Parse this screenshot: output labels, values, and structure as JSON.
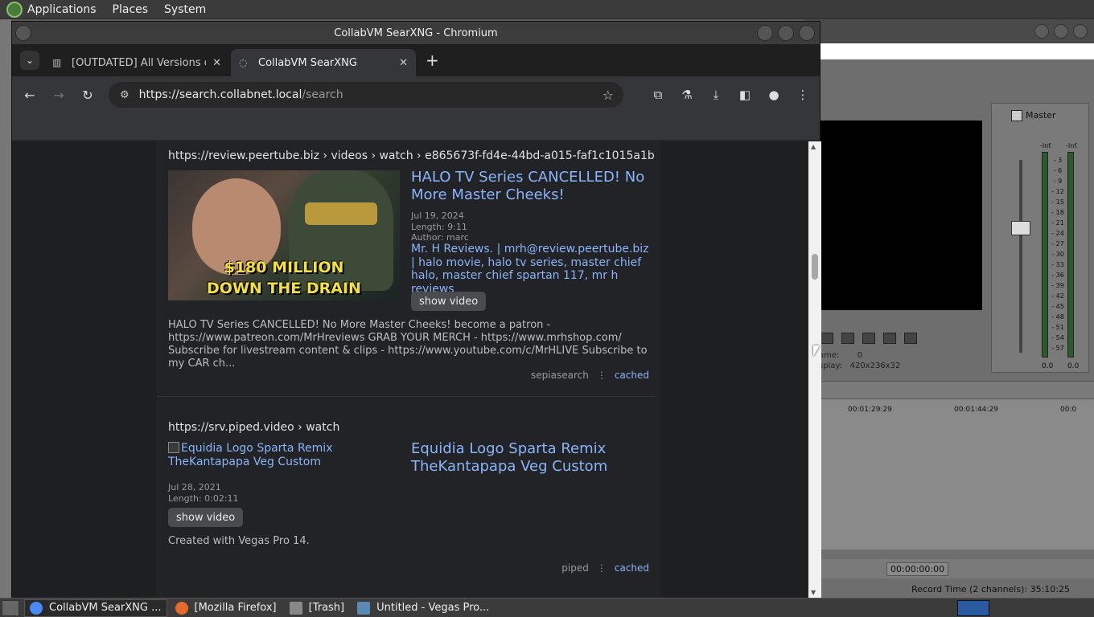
{
  "top_panel": {
    "menus": [
      "Applications",
      "Places",
      "System"
    ]
  },
  "vegas": {
    "master_label": "Master",
    "frame_label": "ame:",
    "frame_value": "0",
    "display_label": "splay:",
    "display_value": "420x236x32",
    "ruler": [
      "00:01:29:29",
      "00:01:44:29",
      "00:0"
    ],
    "timecode": "00:00:00:00",
    "record_time": "Record Time (2 channels): 35:10:25",
    "meter_scale": [
      "3",
      "6",
      "9",
      "12",
      "15",
      "18",
      "21",
      "24",
      "27",
      "30",
      "33",
      "36",
      "39",
      "42",
      "45",
      "48",
      "51",
      "54",
      "57"
    ],
    "inf_left": "-Inf.",
    "inf_right": "-Inf.",
    "zero_left": "0.0",
    "zero_right": "0.0"
  },
  "window": {
    "title": "CollabVM SearXNG - Chromium"
  },
  "tabs": [
    {
      "label": "[OUTDATED] All Versions of",
      "active": false
    },
    {
      "label": "CollabVM SearXNG",
      "active": true
    }
  ],
  "omnibox": {
    "host": "https://search.collabnet.local",
    "path": "/search"
  },
  "results": [
    {
      "url": "https://review.peertube.biz  › videos › watch › e865673f-fd4e-44bd-a015-faf1c1015a1b",
      "thumbnail_caption_1": "$180 MILLION",
      "thumbnail_caption_2": "DOWN THE DRAIN",
      "title": "HALO TV Series CANCELLED! No More Master Cheeks!",
      "date": "Jul 19, 2024",
      "length": "Length: 9:11",
      "author": "Author: marc",
      "tags": "Mr. H Reviews. | mrh@review.peertube.biz | halo movie, halo tv series, master chief halo, master chief spartan 117, mr h reviews",
      "show_video": "show video",
      "content": "HALO TV Series CANCELLED! No More Master Cheeks! become a patron - https://www.patreon.com/MrHreviews GRAB YOUR MERCH - https://www.mrhshop.com/ Subscribe for livestream content & clips - https://www.youtube.com/c/MrHLIVE Subscribe to my CAR ch...",
      "engine": "sepiasearch",
      "cached": "cached"
    },
    {
      "url": "https://srv.piped.video  › watch",
      "img_alt": "Equidia Logo Sparta Remix TheKantapapa Veg Custom",
      "title": "Equidia Logo Sparta Remix TheKantapapa Veg Custom",
      "date": "Jul 28, 2021",
      "length": "Length: 0:02:11",
      "show_video": "show video",
      "content": "Created with Vegas Pro 14.",
      "engine": "piped",
      "cached": "cached"
    }
  ],
  "taskbar": [
    {
      "label": "CollabVM SearXNG ...",
      "active": true
    },
    {
      "label": "[Mozilla Firefox]",
      "active": false
    },
    {
      "label": "[Trash]",
      "active": false
    },
    {
      "label": "Untitled - Vegas Pro...",
      "active": false
    }
  ],
  "colors": {
    "link": "#8ab4f8",
    "page_bg": "#1e1f22",
    "thumb_text": "#f4e23b"
  }
}
